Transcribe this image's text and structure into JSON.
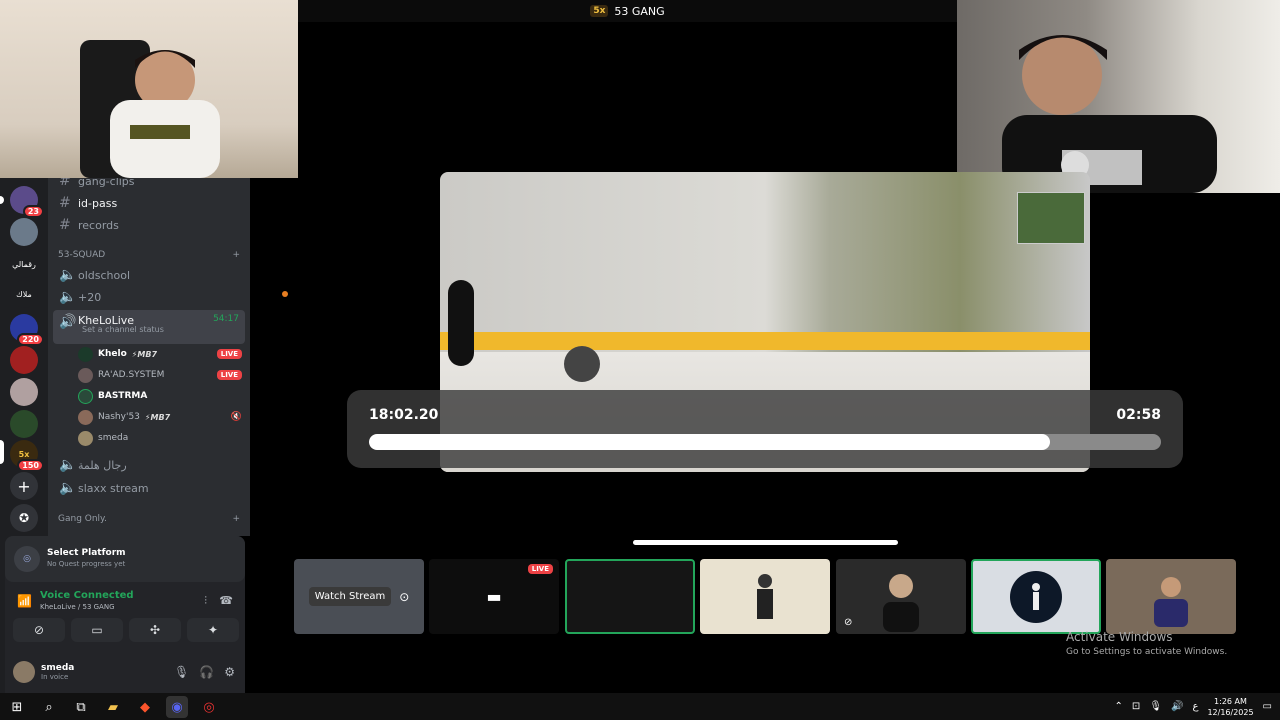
{
  "top_title": {
    "server_mark": "5x",
    "name": "53 GANG"
  },
  "channels": {
    "text": [
      "gang-clips",
      "id-pass",
      "records"
    ],
    "category_squad": "53-SQUAD",
    "voice": [
      "oldschool",
      "+20"
    ],
    "active_voice": {
      "name": "KheLoLive",
      "status": "Set a channel status",
      "time": "54:17"
    },
    "users": [
      {
        "name": "Khelo",
        "tag": "⚡MB7",
        "live": "LIVE"
      },
      {
        "name": "RA'AD.SYSTEM",
        "tag": "",
        "live": "LIVE"
      },
      {
        "name": "BASTRMA",
        "tag": "",
        "live": ""
      },
      {
        "name": "Nashy'53",
        "tag": "⚡MB7",
        "live": ""
      },
      {
        "name": "smeda",
        "tag": "",
        "live": ""
      }
    ],
    "more_voice": [
      "رجال هلمة",
      "slaxx stream"
    ],
    "category_gang": "Gang Only."
  },
  "rail": {
    "badge1": "23",
    "badge2": "220",
    "badge3": "150",
    "label1": "رقمالي",
    "label2": "ملاك"
  },
  "quest": {
    "title": "Select Platform",
    "subtitle": "No Quest progress yet"
  },
  "voice_connected": {
    "title": "Voice Connected",
    "subtitle": "KheLoLive / 53 GANG"
  },
  "me": {
    "name": "smeda",
    "status": "In voice"
  },
  "seek": {
    "elapsed": "18:02.20",
    "remaining": "02:58",
    "progress": 0.86
  },
  "thumbs": {
    "watch_label": "Watch Stream",
    "live": "LIVE"
  },
  "activate": {
    "line1": "Activate Windows",
    "line2": "Go to Settings to activate Windows."
  },
  "taskbar": {
    "time": "1:26 AM",
    "date": "12/16/2025",
    "lang": "ع"
  },
  "colors": {
    "online": "#23a55a",
    "live": "#ed4245",
    "sidebar": "#2b2d31"
  }
}
